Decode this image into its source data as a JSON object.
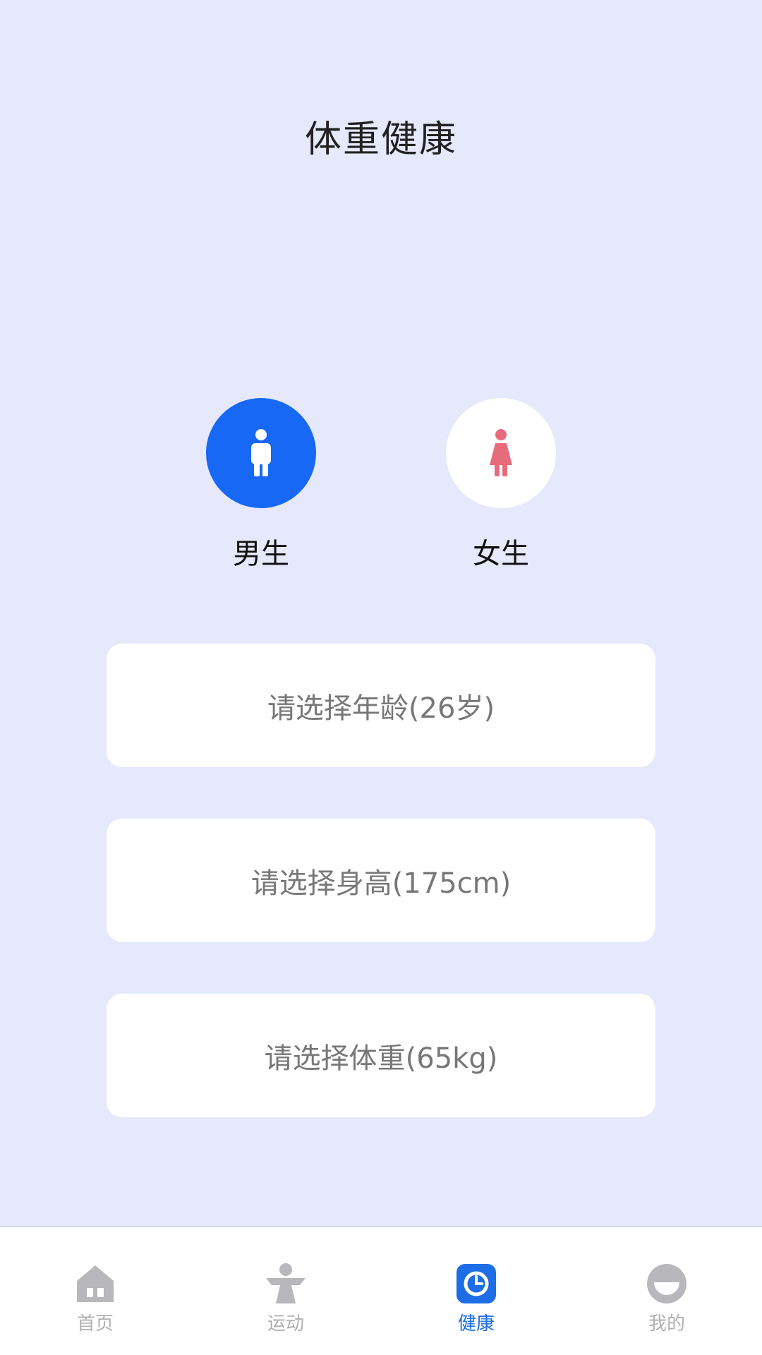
{
  "header": {
    "title": "体重健康"
  },
  "gender": {
    "selected": "male",
    "male_label": "男生",
    "female_label": "女生"
  },
  "fields": {
    "age": "请选择年龄(26岁)",
    "height": "请选择身高(175cm)",
    "weight": "请选择体重(65kg)"
  },
  "tabbar": {
    "active": "health",
    "items": [
      {
        "id": "home",
        "label": "首页",
        "icon": "home-icon"
      },
      {
        "id": "sport",
        "label": "运动",
        "icon": "exercise-person-icon"
      },
      {
        "id": "health",
        "label": "健康",
        "icon": "health-clock-icon"
      },
      {
        "id": "mine",
        "label": "我的",
        "icon": "profile-face-icon"
      }
    ]
  },
  "colors": {
    "background": "#e6e9fc",
    "accent": "#1668f5",
    "female_icon": "#e86b7c",
    "tab_inactive": "#b0b0b0",
    "tab_active": "#1d6ee6"
  }
}
